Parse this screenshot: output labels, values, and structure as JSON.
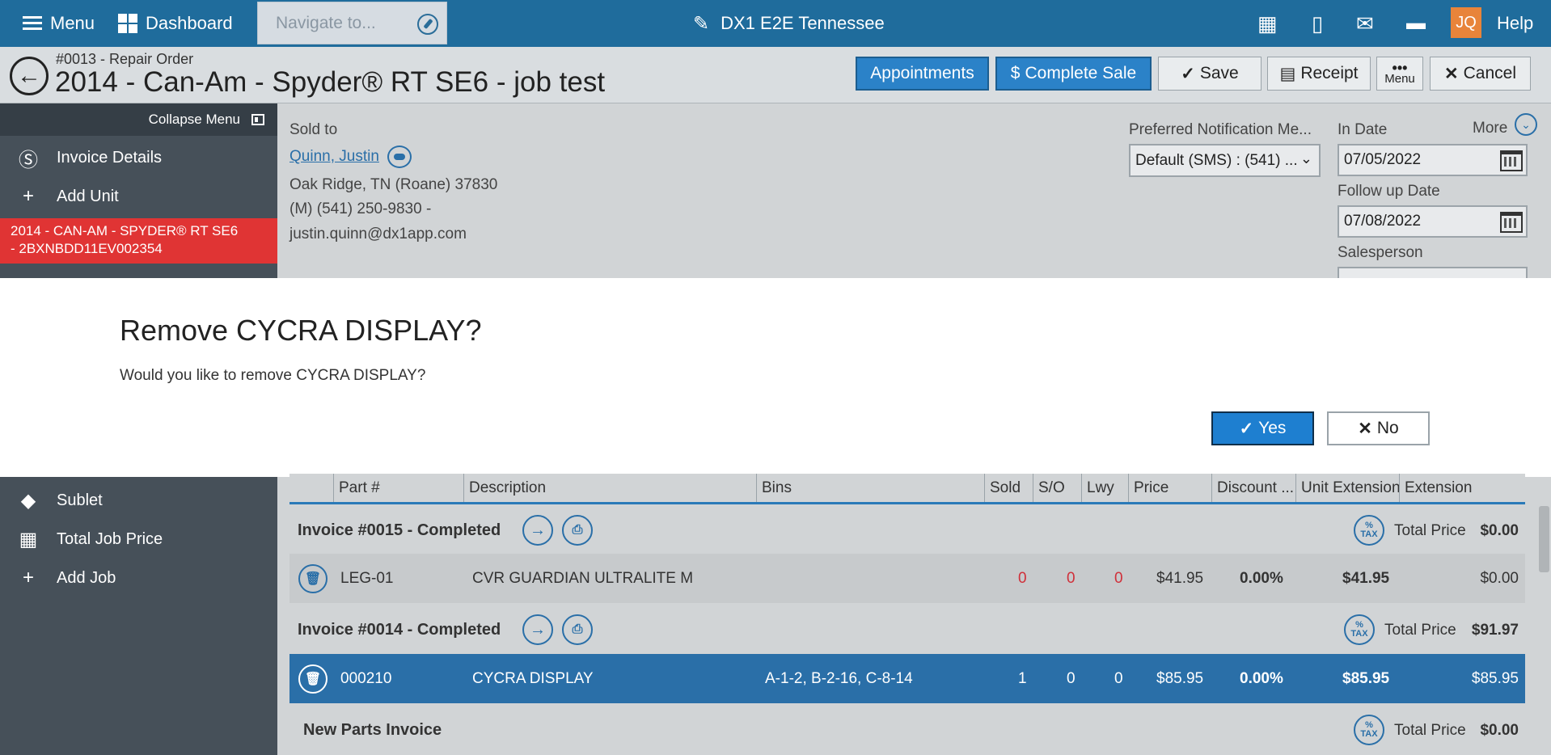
{
  "topbar": {
    "menu_label": "Menu",
    "dashboard_label": "Dashboard",
    "navigate_placeholder": "Navigate to...",
    "store_name": "DX1 E2E Tennessee",
    "user_initials": "JQ",
    "help_label": "Help"
  },
  "header": {
    "ro_label": "#0013 - Repair Order",
    "title": "2014 - Can-Am - Spyder® RT SE6 - job test",
    "buttons": {
      "appointments": "Appointments",
      "complete_sale": "Complete Sale",
      "save": "Save",
      "receipt": "Receipt",
      "menu": "Menu",
      "cancel": "Cancel"
    }
  },
  "sidebar": {
    "collapse_label": "Collapse Menu",
    "invoice_details": "Invoice Details",
    "add_unit": "Add Unit",
    "unit_line1": "2014 - CAN-AM - SPYDER® RT SE6",
    "unit_line2": "- 2BXNBDD11EV002354",
    "sublet": "Sublet",
    "total_job_price": "Total Job Price",
    "add_job": "Add Job"
  },
  "customer": {
    "sold_to_label": "Sold to",
    "name": "Quinn, Justin",
    "address": "Oak Ridge, TN (Roane) 37830",
    "phone": "(M) (541) 250-9830 -",
    "email": "justin.quinn@dx1app.com"
  },
  "notification": {
    "label": "Preferred Notification Me...",
    "value": "Default (SMS) : (541) ..."
  },
  "dates": {
    "more_label": "More",
    "in_date_label": "In Date",
    "in_date": "07/05/2022",
    "follow_up_label": "Follow up Date",
    "follow_up": "07/08/2022",
    "salesperson_label": "Salesperson"
  },
  "modal": {
    "title": "Remove CYCRA DISPLAY?",
    "message": "Would you like to remove CYCRA DISPLAY?",
    "yes": "Yes",
    "no": "No"
  },
  "table": {
    "headers": [
      "Part #",
      "Description",
      "Bins",
      "Sold",
      "S/O",
      "Lwy",
      "Price",
      "Discount ...",
      "Unit Extension",
      "Extension"
    ],
    "total_price_label": "Total Price",
    "tax_label": "%\nTAX",
    "groups": [
      {
        "title": "Invoice #0015 - Completed",
        "total": "$0.00",
        "item": {
          "part": "LEG-01",
          "description": "CVR GUARDIAN ULTRALITE M",
          "bins": "",
          "sold": "0",
          "so": "0",
          "lwy": "0",
          "price": "$41.95",
          "discount": "0.00%",
          "unit_ext": "$41.95",
          "ext": "$0.00"
        }
      },
      {
        "title": "Invoice #0014 - Completed",
        "total": "$91.97",
        "item": {
          "part": "000210",
          "description": "CYCRA DISPLAY",
          "bins": "A-1-2, B-2-16, C-8-14",
          "sold": "1",
          "so": "0",
          "lwy": "0",
          "price": "$85.95",
          "discount": "0.00%",
          "unit_ext": "$85.95",
          "ext": "$85.95"
        }
      },
      {
        "title": "New Parts Invoice",
        "total": "$0.00"
      }
    ]
  }
}
